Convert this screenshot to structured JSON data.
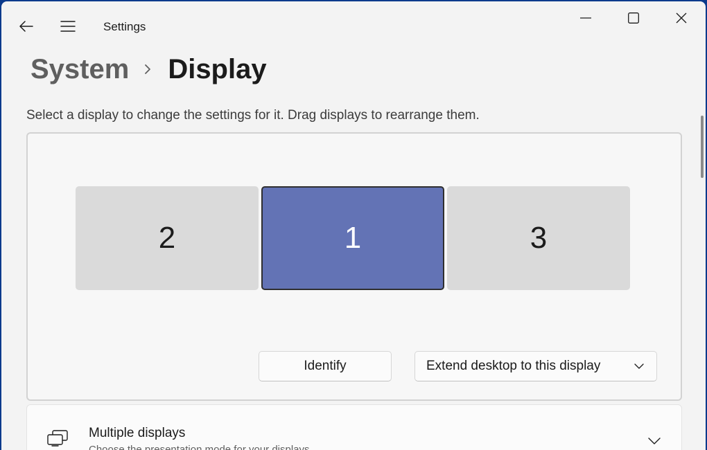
{
  "window": {
    "title": "Settings"
  },
  "breadcrumb": {
    "parent": "System",
    "current": "Display"
  },
  "instruction": "Select a display to change the settings for it. Drag displays to rearrange them.",
  "displays": [
    {
      "label": "2",
      "selected": false
    },
    {
      "label": "1",
      "selected": true
    },
    {
      "label": "3",
      "selected": false
    }
  ],
  "buttons": {
    "identify": "Identify",
    "mode_dropdown": "Extend desktop to this display"
  },
  "multiple_displays": {
    "title": "Multiple displays",
    "subtitle": "Choose the presentation mode for your displays"
  },
  "icons": {
    "back": "back-arrow-icon",
    "menu": "hamburger-menu-icon",
    "minimize": "minimize-icon",
    "maximize": "maximize-icon",
    "close": "close-icon",
    "breadcrumb_sep": "chevron-right-icon",
    "dropdown": "chevron-down-icon",
    "multiple_displays": "multiple-displays-icon"
  },
  "colors": {
    "selected_display": "#6373b5",
    "inactive_display": "#dadada",
    "window_background": "#f3f3f3"
  }
}
